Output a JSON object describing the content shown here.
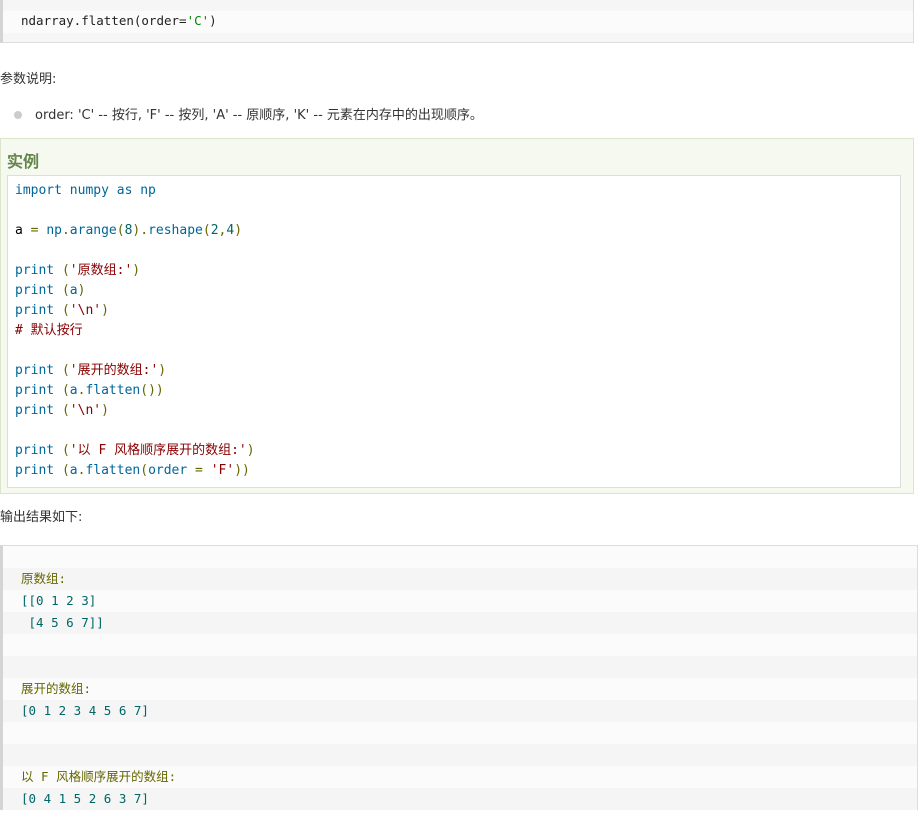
{
  "syntax": {
    "prefix": "ndarray.flatten(order=",
    "arg": "'C'",
    "suffix": ")"
  },
  "params": {
    "heading": "参数说明:",
    "items": [
      "order: 'C' -- 按行, 'F' -- 按列, 'A' -- 原顺序, 'K' -- 元素在内存中的出现顺序。"
    ]
  },
  "example": {
    "title": "实例",
    "lines": [
      [
        {
          "t": "import numpy as np",
          "c": "kw"
        }
      ],
      [],
      [
        {
          "t": "a ",
          "c": ""
        },
        {
          "t": "= ",
          "c": "punc"
        },
        {
          "t": "np",
          "c": "fn"
        },
        {
          "t": ".",
          "c": "punc"
        },
        {
          "t": "arange",
          "c": "fn"
        },
        {
          "t": "(",
          "c": "punc"
        },
        {
          "t": "8",
          "c": "num"
        },
        {
          "t": ").",
          "c": "punc"
        },
        {
          "t": "reshape",
          "c": "fn"
        },
        {
          "t": "(",
          "c": "punc"
        },
        {
          "t": "2",
          "c": "num"
        },
        {
          "t": ",",
          "c": "punc"
        },
        {
          "t": "4",
          "c": "num"
        },
        {
          "t": ")",
          "c": "punc"
        }
      ],
      [],
      [
        {
          "t": "print ",
          "c": "kw"
        },
        {
          "t": "(",
          "c": "punc"
        },
        {
          "t": "'原数组:'",
          "c": "str2"
        },
        {
          "t": ")",
          "c": "punc"
        }
      ],
      [
        {
          "t": "print ",
          "c": "kw"
        },
        {
          "t": "(",
          "c": "punc"
        },
        {
          "t": "a",
          "c": "fn"
        },
        {
          "t": ")",
          "c": "punc"
        }
      ],
      [
        {
          "t": "print ",
          "c": "kw"
        },
        {
          "t": "(",
          "c": "punc"
        },
        {
          "t": "'\\n'",
          "c": "str2"
        },
        {
          "t": ")",
          "c": "punc"
        }
      ],
      [
        {
          "t": "# 默认按行",
          "c": "cmt"
        }
      ],
      [],
      [
        {
          "t": "print ",
          "c": "kw"
        },
        {
          "t": "(",
          "c": "punc"
        },
        {
          "t": "'展开的数组:'",
          "c": "str2"
        },
        {
          "t": ")",
          "c": "punc"
        }
      ],
      [
        {
          "t": "print ",
          "c": "kw"
        },
        {
          "t": "(",
          "c": "punc"
        },
        {
          "t": "a",
          "c": "fn"
        },
        {
          "t": ".",
          "c": "punc"
        },
        {
          "t": "flatten",
          "c": "fn"
        },
        {
          "t": "())",
          "c": "punc"
        }
      ],
      [
        {
          "t": "print ",
          "c": "kw"
        },
        {
          "t": "(",
          "c": "punc"
        },
        {
          "t": "'\\n'",
          "c": "str2"
        },
        {
          "t": ")",
          "c": "punc"
        }
      ],
      [],
      [
        {
          "t": "print ",
          "c": "kw"
        },
        {
          "t": "(",
          "c": "punc"
        },
        {
          "t": "'以 F 风格顺序展开的数组:'",
          "c": "str2"
        },
        {
          "t": ")",
          "c": "punc"
        }
      ],
      [
        {
          "t": "print ",
          "c": "kw"
        },
        {
          "t": "(",
          "c": "punc"
        },
        {
          "t": "a",
          "c": "fn"
        },
        {
          "t": ".",
          "c": "punc"
        },
        {
          "t": "flatten",
          "c": "fn"
        },
        {
          "t": "(",
          "c": "punc"
        },
        {
          "t": "order ",
          "c": "fn"
        },
        {
          "t": "= ",
          "c": "punc"
        },
        {
          "t": "'F'",
          "c": "str2"
        },
        {
          "t": "))",
          "c": "punc"
        }
      ]
    ]
  },
  "output": {
    "heading": "输出结果如下:",
    "lines": [
      {
        "t": "",
        "c": "label"
      },
      {
        "t": "原数组:",
        "c": "label"
      },
      {
        "t": "[[0 1 2 3]",
        "c": "num"
      },
      {
        "t": " [4 5 6 7]]",
        "c": "num"
      },
      {
        "t": "",
        "c": "label"
      },
      {
        "t": "",
        "c": "label"
      },
      {
        "t": "展开的数组:",
        "c": "label"
      },
      {
        "t": "[0 1 2 3 4 5 6 7]",
        "c": "num"
      },
      {
        "t": "",
        "c": "label"
      },
      {
        "t": "",
        "c": "label"
      },
      {
        "t": "以 F 风格顺序展开的数组:",
        "c": "label"
      },
      {
        "t": "[0 4 1 5 2 6 3 7]",
        "c": "num"
      }
    ]
  }
}
